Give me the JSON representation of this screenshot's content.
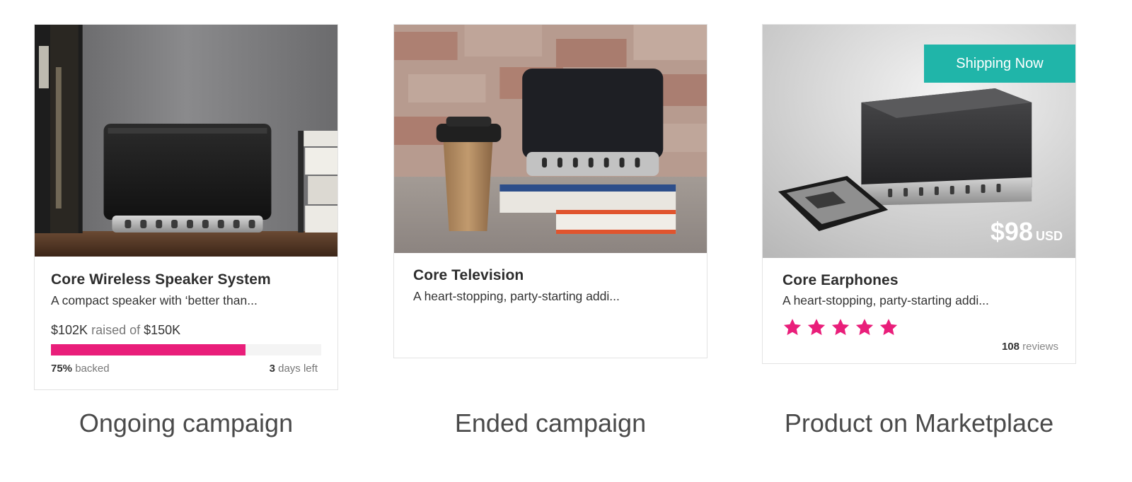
{
  "cards": {
    "ongoing": {
      "image": "wireless-speaker-on-shelf-photo",
      "title": "Core Wireless Speaker System",
      "description": "A compact speaker with ‘better than...",
      "raised_amount": "$102K",
      "raised_text": "raised of",
      "goal_amount": "$150K",
      "progress_fraction": 0.72,
      "backed_percent": "75%",
      "backed_label": "backed",
      "days_left": "3",
      "days_left_label": "days left",
      "accent_color": "#e91e7a"
    },
    "ended": {
      "image": "speaker-with-coffee-cup-photo",
      "title": "Core Television",
      "description": "A heart-stopping, party-starting addi..."
    },
    "market": {
      "image": "speaker-with-phone-photo",
      "badge": "Shipping Now",
      "badge_color": "#20b5a9",
      "price": "$98",
      "currency": "USD",
      "title": "Core Earphones",
      "description": "A heart-stopping, party-starting addi...",
      "rating": 5,
      "rating_max": 5,
      "star_color": "#e91e7a",
      "review_count": "108",
      "review_label": "reviews"
    }
  },
  "captions": {
    "ongoing": "Ongoing campaign",
    "ended": "Ended campaign",
    "market": "Product on Marketplace"
  }
}
